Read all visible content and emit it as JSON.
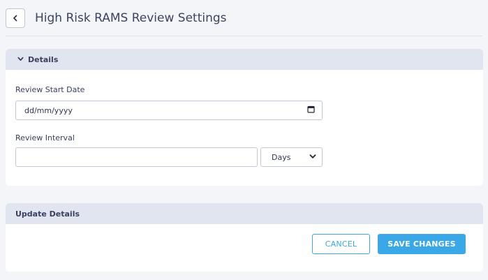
{
  "header": {
    "title": "High Risk RAMS Review Settings"
  },
  "details": {
    "section_title": "Details",
    "review_start_date": {
      "label": "Review Start Date",
      "placeholder": "dd/mm/yyyy",
      "value": ""
    },
    "review_interval": {
      "label": "Review Interval",
      "value": "",
      "unit": {
        "selected": "Days"
      }
    }
  },
  "update": {
    "section_title": "Update Details",
    "cancel_label": "CANCEL",
    "save_label": "SAVE CHANGES"
  },
  "colors": {
    "accent": "#3aa8e6",
    "section_header_bg": "#e0e5f0",
    "page_bg": "#f4f5f8"
  },
  "icons": {
    "back": "chevron-left-icon",
    "section_toggle": "chevron-down-icon",
    "date_picker": "calendar-icon",
    "select_arrow": "chevron-down-icon"
  }
}
